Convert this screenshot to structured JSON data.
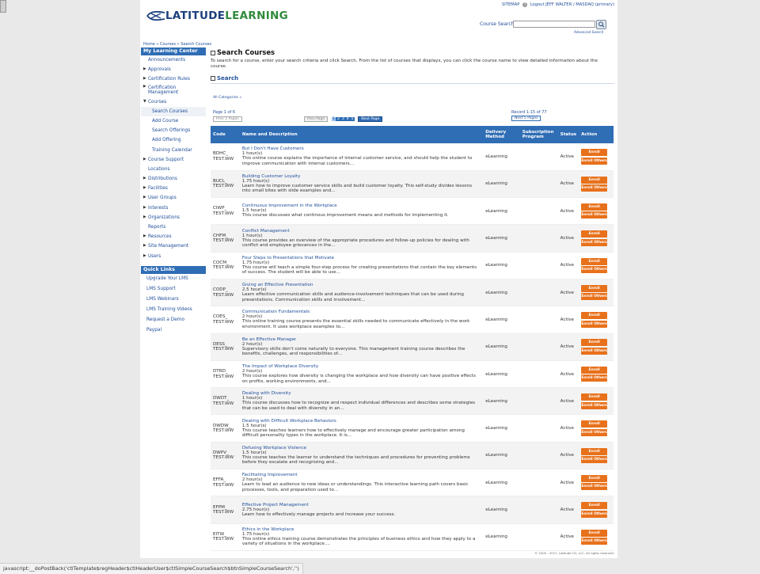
{
  "header": {
    "sitemap": "SITEMAP",
    "help": "?",
    "logout": "Logout",
    "user": "JEFF WALTER / MASDAQ (primary)",
    "logo_left": "LATITUDE",
    "logo_right": "LEARNING",
    "course_search_label": "Course Search",
    "course_search_value": "",
    "advanced_search": "Advanced Search"
  },
  "breadcrumb": "Home » Courses » Search Courses",
  "sidebar": {
    "title": "My Learning Center",
    "items": [
      {
        "label": "Announcements",
        "kind": "plain"
      },
      {
        "label": "Approvals",
        "kind": "arrow"
      },
      {
        "label": "Certification Rules",
        "kind": "arrow"
      },
      {
        "label": "Certification Management",
        "kind": "arrow"
      },
      {
        "label": "Courses",
        "kind": "open"
      },
      {
        "label": "Search Courses",
        "kind": "sub-active"
      },
      {
        "label": "Add Course",
        "kind": "sub"
      },
      {
        "label": "Search Offerings",
        "kind": "sub"
      },
      {
        "label": "Add Offering",
        "kind": "sub"
      },
      {
        "label": "Training Calendar",
        "kind": "sub"
      },
      {
        "label": "Course Support",
        "kind": "arrow"
      },
      {
        "label": "Locations",
        "kind": "plain"
      },
      {
        "label": "Distributions",
        "kind": "arrow"
      },
      {
        "label": "Facilities",
        "kind": "arrow"
      },
      {
        "label": "User Groups",
        "kind": "arrow"
      },
      {
        "label": "Interests",
        "kind": "arrow"
      },
      {
        "label": "Organizations",
        "kind": "arrow"
      },
      {
        "label": "Reports",
        "kind": "plain"
      },
      {
        "label": "Resources",
        "kind": "arrow"
      },
      {
        "label": "Site Management",
        "kind": "arrow"
      },
      {
        "label": "Users",
        "kind": "arrow"
      }
    ],
    "quick_links_title": "Quick Links",
    "quick_links": [
      "Upgrade Your LMS",
      "LMS Support",
      "LMS Webinars",
      "LMS Training Videos",
      "Request a Demo",
      "Paypal"
    ]
  },
  "main": {
    "title": "Search Courses",
    "intro": "To search for a course, enter your search criteria and click Search. From the list of courses that displays, you can click the course name to view detailed information about the course.",
    "search_section": "Search",
    "categories": "All Categories »",
    "page_of": "Page 1 of 6",
    "prev5": "Prev 5 Pages",
    "prev_page": "Prev Page",
    "pages": [
      "1",
      "2",
      "3",
      "4",
      "5"
    ],
    "next_page": "Next Page",
    "record": "Record 1-15 of 77",
    "next5": "Next 5 Pages",
    "columns": {
      "code": "Code",
      "name": "Name and Description",
      "delivery": "Delivery Method",
      "subscription": "Subscription Program",
      "status": "Status",
      "action": "Action"
    },
    "enroll": "Enroll",
    "enroll_others": "Enroll Others",
    "courses": [
      {
        "code": "BDHC_ TEST.WW",
        "name": "But I Don't Have Customers",
        "hours": "1 hour(s)",
        "desc": "This online course explains the importance of internal customer service, and should help the student to improve communication with internal customers...",
        "delivery": "eLearning",
        "status": "Active"
      },
      {
        "code": "BUCL_ TEST.WW",
        "name": "Building Customer Loyalty",
        "hours": "1.75 hour(s)",
        "desc": "Learn how to improve customer service skills and build customer loyalty. This self-study divides lessons into small bites with slide examples and...",
        "delivery": "eLearning",
        "status": "Active"
      },
      {
        "code": "CIWP_ TEST.WW",
        "name": "Continuous Improvement in the Workplace",
        "hours": "1.5 hour(s)",
        "desc": "This course discusses what continous improvement means and methods for implementing it.",
        "delivery": "eLearning",
        "status": "Active"
      },
      {
        "code": "CHFM_ TEST.WW",
        "name": "Conflict Management",
        "hours": "1 hour(s)",
        "desc": "This course provides an overview of the appropriate procedures and follow-up policies for dealing with conflict and employee grievances in the...",
        "delivery": "eLearning",
        "status": "Active"
      },
      {
        "code": "COCM_ TEST.WW",
        "name": "Four Steps to Presentations that Motivate",
        "hours": "1.75 hour(s)",
        "desc": "This course will teach a simple four-step process for creating presentations that contain the key elements of success. The student will be able to use...",
        "delivery": "eLearning",
        "status": "Active"
      },
      {
        "code": "CODP_ TEST.WW",
        "name": "Giving an Effective Presentation",
        "hours": "2.5 hour(s)",
        "desc": "Learn effective communication skills and audience-involvement techniques that can be used during presentations. Communication skills and involvement...",
        "delivery": "eLearning",
        "status": "Active"
      },
      {
        "code": "COES_ TEST.WW",
        "name": "Communication Fundamentals",
        "hours": "2 hour(s)",
        "desc": "This online training course presents the essential skills needed to communicate effectively in the work environment. It uses workplace examples to...",
        "delivery": "eLearning",
        "status": "Active"
      },
      {
        "code": "DESS_ TEST.WW",
        "name": "Be an Effective Manager",
        "hours": "2 hour(s)",
        "desc": "Supervisory skills don't come naturally to everyone. This management training course describes the benefits, challenges, and responsibilities of...",
        "delivery": "eLearning",
        "status": "Active"
      },
      {
        "code": "DTRD_ TEST.WW",
        "name": "The Impact of Workplace Diversity",
        "hours": "2 hour(s)",
        "desc": "This course explores how diversity is changing the workplace and how diversity can have positive effects on profits, working environments, and...",
        "delivery": "eLearning",
        "status": "Active"
      },
      {
        "code": "DWDT_ TEST.WW",
        "name": "Dealing with Diversity",
        "hours": "1 hour(s)",
        "desc": "This course discusses how to recognize and respect individual differences and describes some strategies that can be used to deal with diversity in an...",
        "delivery": "eLearning",
        "status": "Active"
      },
      {
        "code": "DWDW_ TEST.WW",
        "name": "Dealing with Difficult Workplace Behaviors",
        "hours": "1.5 hour(s)",
        "desc": "This course teaches learners how to effectively manage and encourage greater participation among difficult personality types in the workplace. It is...",
        "delivery": "eLearning",
        "status": "Active"
      },
      {
        "code": "DWPV_ TEST.WW",
        "name": "Defusing Workplace Violence",
        "hours": "1.5 hour(s)",
        "desc": "This course teaches the learner to understand the techniques and procedures for preventing problems before they escalate and recognizing and...",
        "delivery": "eLearning",
        "status": "Active"
      },
      {
        "code": "EFFA_ TEST.WW",
        "name": "Facilitating Improvement",
        "hours": "2 hour(s)",
        "desc": "Learn to lead an audience to new ideas or understandings. This interactive learning path covers basic processes, tools, and preparation used to...",
        "delivery": "eLearning",
        "status": "Active"
      },
      {
        "code": "EFPM_ TEST.WW",
        "name": "Effective Project Management",
        "hours": "2.75 hour(s)",
        "desc": "Learn how to effectively manage projects and increase your success.",
        "delivery": "eLearning",
        "status": "Active"
      },
      {
        "code": "EITW_ TEST.WW",
        "name": "Ethics in the Workplace",
        "hours": "1.75 hour(s)",
        "desc": "This online ethics training course demonstrates the principles of business ethics and how they apply to a variety of situations in the workplace....",
        "delivery": "eLearning",
        "status": "Active"
      }
    ]
  },
  "footer": "© 2005 - 2017, Latitude CG, LLC. All rights reserved.",
  "statusbar": "javascript:__doPostBack('ctlTemplate$regHeader$ctlHeaderUser$ctlSimpleCourseSearch$btnSimpleCourseSearch','')",
  "colors": {
    "accent": "#2f6db5",
    "enroll": "#e8711b",
    "logo_blue": "#1c3f7d",
    "logo_green": "#2f8a3a"
  }
}
